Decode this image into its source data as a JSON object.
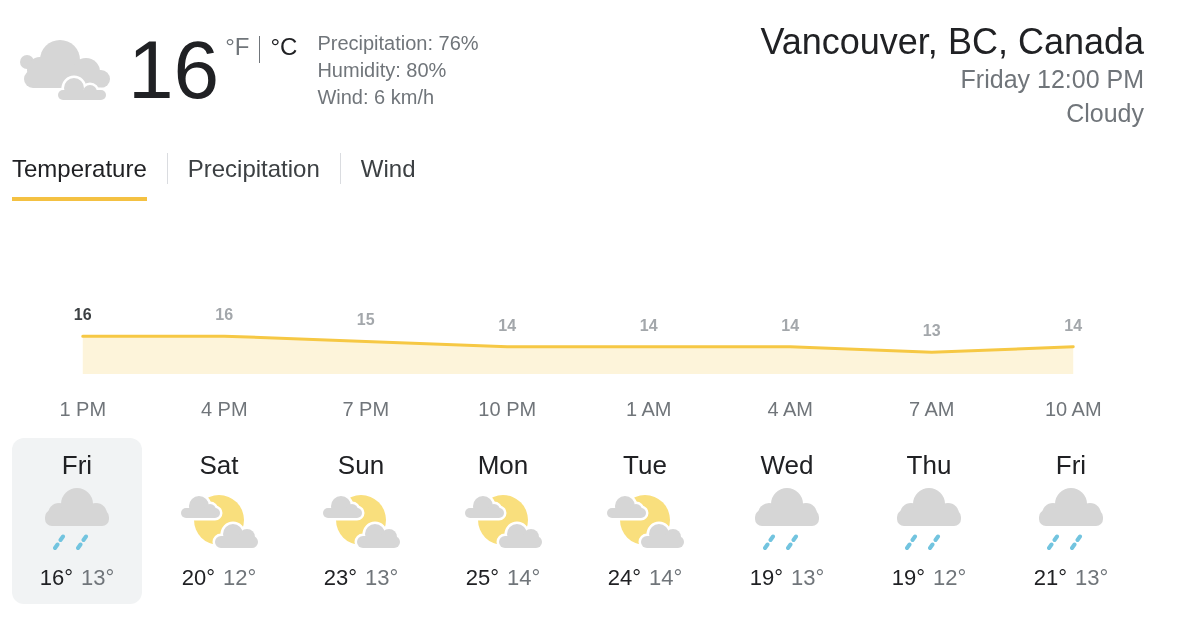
{
  "current": {
    "kind": "cloudy",
    "temperature": "16",
    "units": [
      {
        "label": "°F",
        "selected": false
      },
      {
        "label": "°C",
        "selected": true
      }
    ],
    "details": [
      "Precipitation: 76%",
      "Humidity: 80%",
      "Wind: 6 km/h"
    ]
  },
  "location": {
    "name": "Vancouver, BC, Canada",
    "time": "Friday 12:00 PM",
    "condition": "Cloudy"
  },
  "tabs": [
    {
      "label": "Temperature",
      "selected": true
    },
    {
      "label": "Precipitation",
      "selected": false
    },
    {
      "label": "Wind",
      "selected": false
    }
  ],
  "temperature_chart": {
    "chart_data": {
      "type": "area",
      "categories": [
        "1 PM",
        "4 PM",
        "7 PM",
        "10 PM",
        "1 AM",
        "4 AM",
        "7 AM",
        "10 AM"
      ],
      "series": [
        {
          "color": "#f6c844",
          "values": [
            16,
            16,
            15,
            14,
            14,
            14,
            13,
            14
          ]
        }
      ],
      "data_labels": true
    }
  },
  "days": [
    {
      "name": "Fri",
      "kind": "rain",
      "high": "16°",
      "low": "13°",
      "selected": true
    },
    {
      "name": "Sat",
      "kind": "partly_cloudy",
      "high": "20°",
      "low": "12°",
      "selected": false
    },
    {
      "name": "Sun",
      "kind": "partly_cloudy",
      "high": "23°",
      "low": "13°",
      "selected": false
    },
    {
      "name": "Mon",
      "kind": "partly_cloudy",
      "high": "25°",
      "low": "14°",
      "selected": false
    },
    {
      "name": "Tue",
      "kind": "partly_cloudy",
      "high": "24°",
      "low": "14°",
      "selected": false
    },
    {
      "name": "Wed",
      "kind": "rain",
      "high": "19°",
      "low": "13°",
      "selected": false
    },
    {
      "name": "Thu",
      "kind": "rain",
      "high": "19°",
      "low": "12°",
      "selected": false
    },
    {
      "name": "Fri",
      "kind": "rain",
      "high": "21°",
      "low": "13°",
      "selected": false
    }
  ]
}
